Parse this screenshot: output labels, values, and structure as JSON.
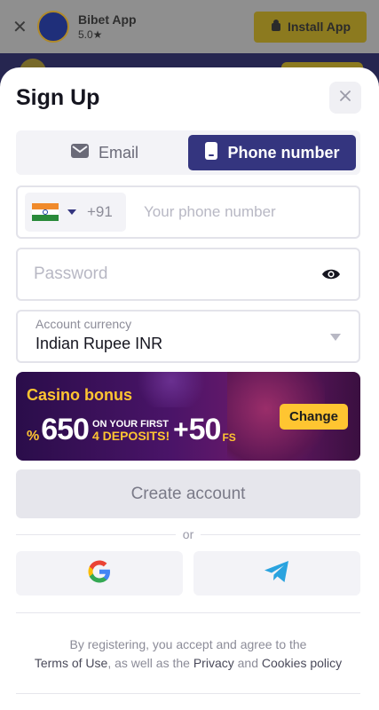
{
  "background_banner": {
    "app_name": "Bibet App",
    "rating": "5.0★",
    "install_label": "Install App"
  },
  "modal": {
    "title": "Sign Up"
  },
  "tabs": [
    {
      "label": "Email",
      "icon": "mail-icon",
      "active": false
    },
    {
      "label": "Phone number",
      "icon": "phone-icon",
      "active": true
    }
  ],
  "phone": {
    "country_flag": "india-flag-icon",
    "dial_code": "+91",
    "placeholder": "Your phone number",
    "value": ""
  },
  "password": {
    "placeholder": "Password",
    "value": ""
  },
  "currency": {
    "label": "Account currency",
    "value": "Indian Rupee INR"
  },
  "bonus": {
    "title": "Casino bonus",
    "percent_sign": "%",
    "amount": "650",
    "line1": "ON YOUR FIRST",
    "line2": "4 DEPOSITS!",
    "plus": "+",
    "free_spins": "50",
    "fs_label": "FS",
    "change_label": "Change"
  },
  "create_account_label": "Create account",
  "or_label": "or",
  "social": [
    {
      "name": "google",
      "icon": "google-icon"
    },
    {
      "name": "telegram",
      "icon": "telegram-icon"
    }
  ],
  "terms": {
    "prefix": "By registering, you accept and agree to the",
    "terms_link": "Terms of Use",
    "mid": ", as well as the",
    "privacy_link": "Privacy",
    "and": "and",
    "cookies_link": "Cookies policy"
  },
  "colors": {
    "accent": "#34357f",
    "bonus_yellow": "#ffc531",
    "telegram_blue": "#2aa3df"
  }
}
